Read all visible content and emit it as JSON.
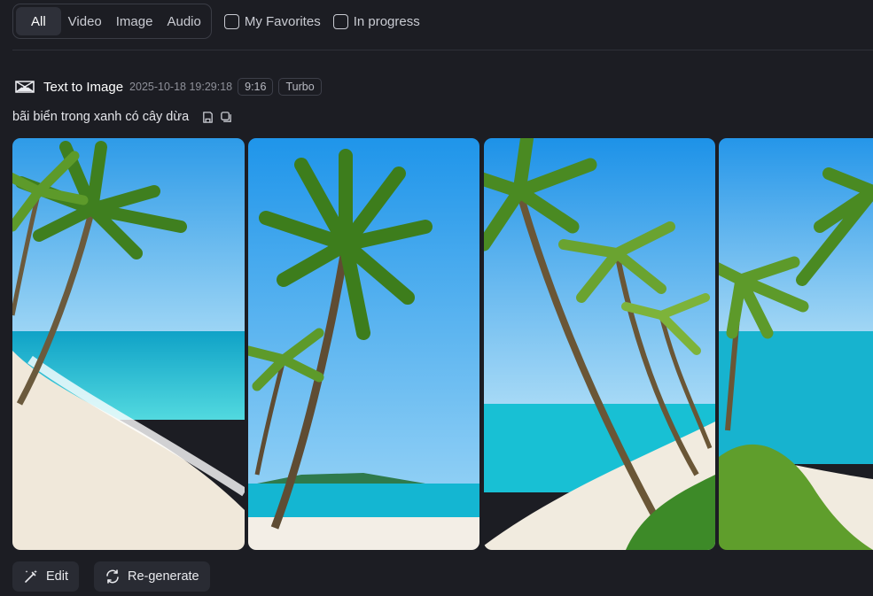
{
  "filters": {
    "tabs": [
      {
        "label": "All",
        "active": true
      },
      {
        "label": "Video",
        "active": false
      },
      {
        "label": "Image",
        "active": false
      },
      {
        "label": "Audio",
        "active": false
      }
    ],
    "checkboxes": [
      {
        "label": "My Favorites",
        "checked": false
      },
      {
        "label": "In progress",
        "checked": false
      }
    ]
  },
  "task": {
    "icon": "text-to-image-icon",
    "title": "Text to Image",
    "timestamp": "2025-10-18 19:29:18",
    "tags": [
      "9:16",
      "Turbo"
    ],
    "prompt": "bãi biển trong xanh có cây dừa"
  },
  "images": [
    {
      "name": "generated-image-1",
      "description": "palm trees on white beach"
    },
    {
      "name": "generated-image-2",
      "description": "tall palm tree beach"
    },
    {
      "name": "generated-image-3",
      "description": "leaning palms beach"
    },
    {
      "name": "generated-image-4",
      "description": "palm beach partial"
    }
  ],
  "actions": {
    "edit_label": "Edit",
    "regenerate_label": "Re-generate"
  },
  "colors": {
    "background": "#1c1d23",
    "panel": "#292b33",
    "border": "#3a3c45",
    "sky": "#3aa6ee",
    "sea": "#1fc7d6",
    "sand": "#f1ebdf",
    "palm": "#5d9a2a"
  }
}
